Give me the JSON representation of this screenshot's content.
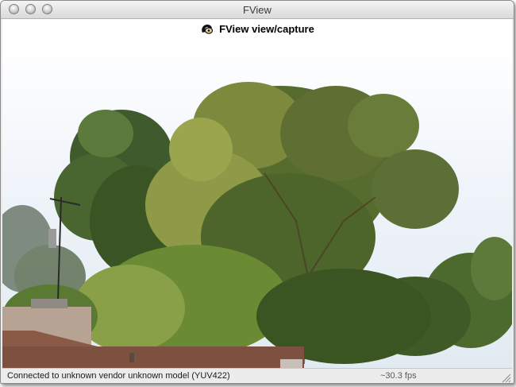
{
  "window": {
    "title": "FView",
    "controls": [
      "close-button",
      "minimize-button",
      "zoom-button"
    ]
  },
  "header": {
    "icon": "camera-app-icon",
    "title": "FView view/capture"
  },
  "video": {
    "content": "live-camera-feed"
  },
  "status": {
    "connection": "Connected to unknown vendor unknown model (YUV422)",
    "fps": "~30.3 fps"
  },
  "colors": {
    "sky": "#f2f6fb",
    "foliage_dark": "#3d5a22",
    "foliage_light": "#a4b05a",
    "roof": "#8a5a45",
    "chimney": "#b8a090"
  }
}
